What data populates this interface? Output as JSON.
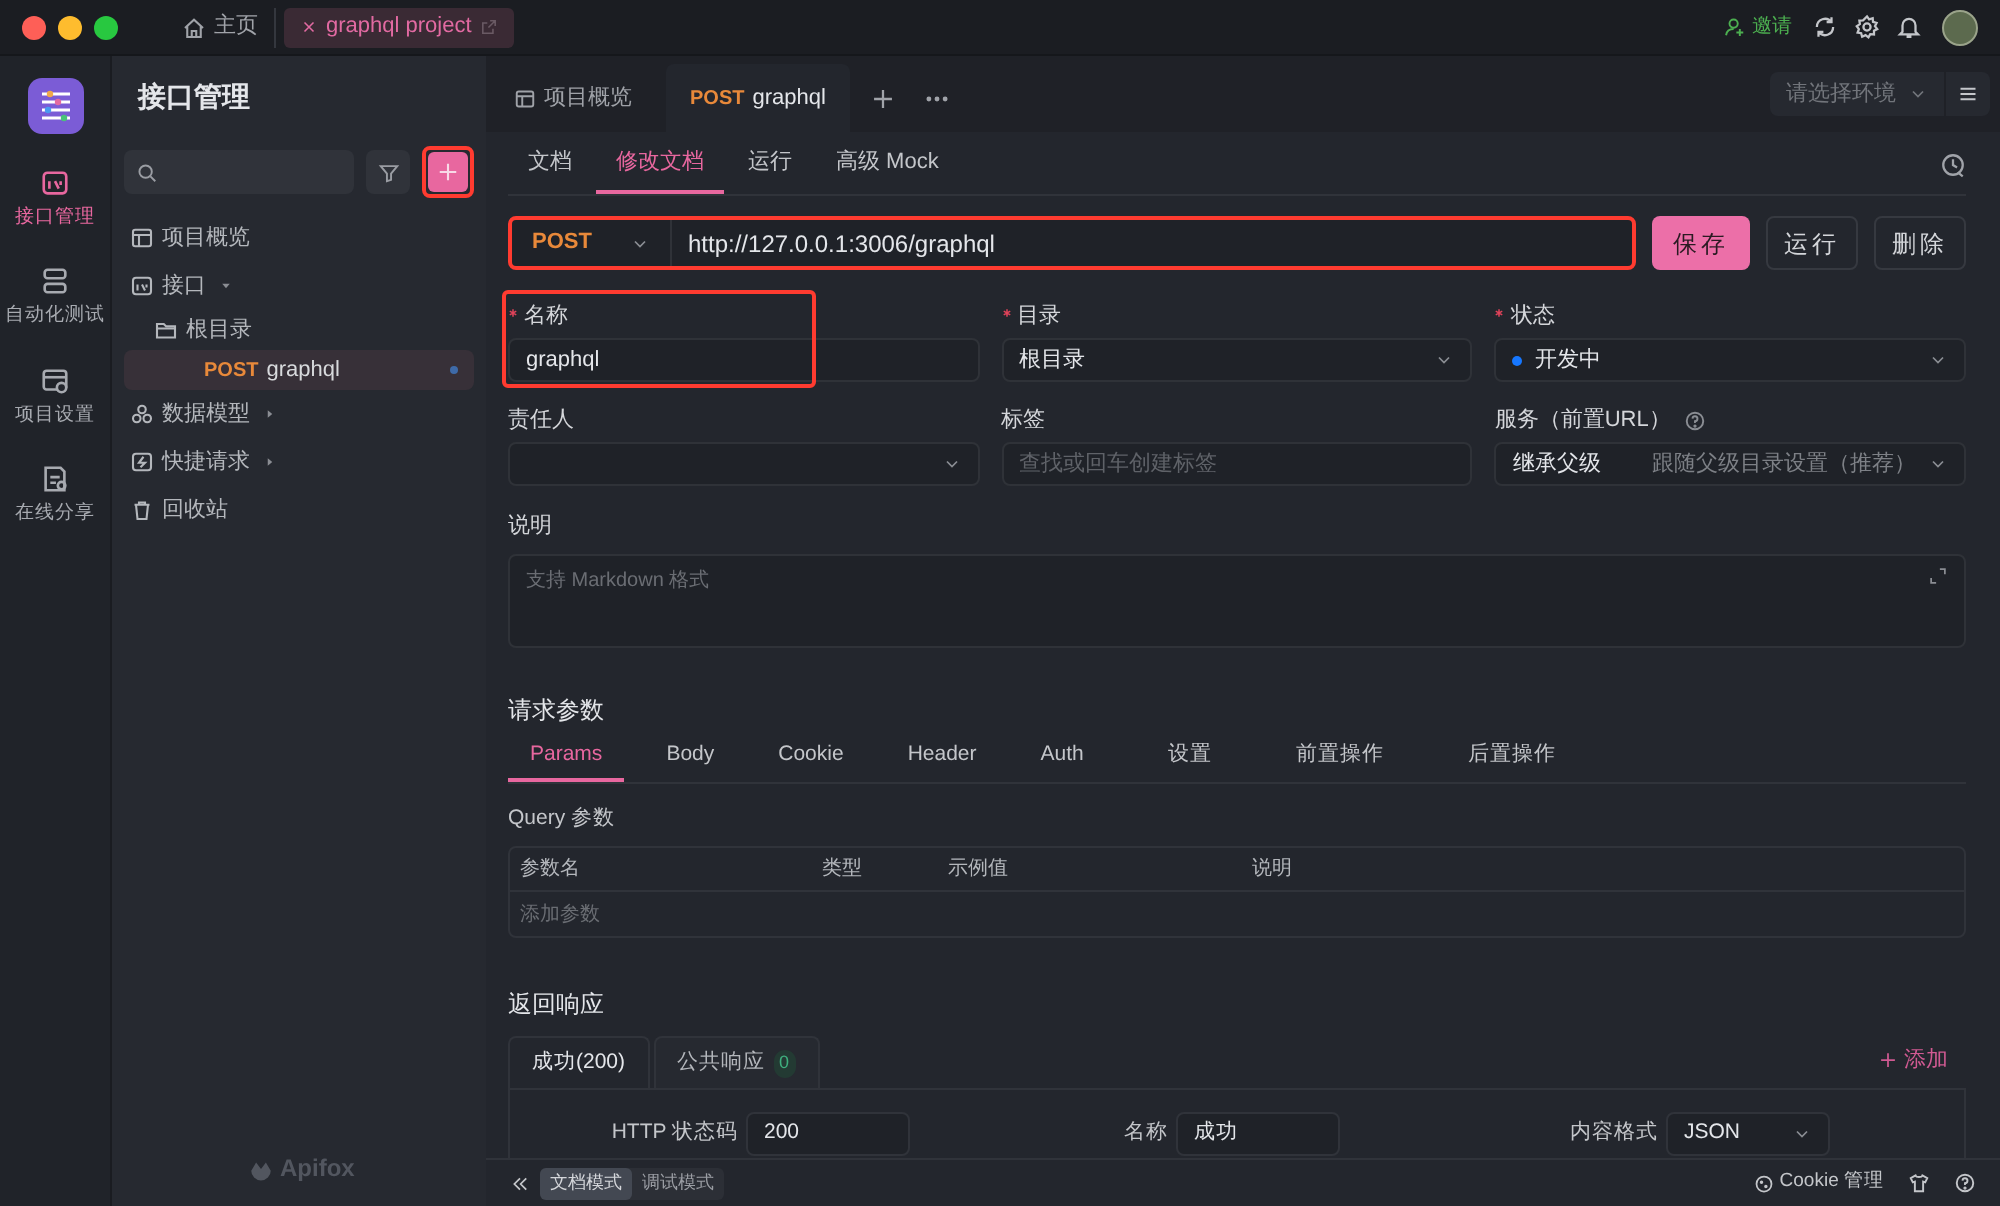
{
  "titlebar": {
    "tabs": [
      {
        "label": "主页",
        "kind": "home",
        "selected": false
      },
      {
        "label": "graphql project",
        "kind": "project",
        "selected": true
      }
    ],
    "invite": "邀请"
  },
  "rail": {
    "items": [
      {
        "label": "接口管理",
        "kind": "api",
        "selected": true
      },
      {
        "label": "自动化测试",
        "kind": "test",
        "selected": false
      },
      {
        "label": "项目设置",
        "kind": "settings",
        "selected": false
      },
      {
        "label": "在线分享",
        "kind": "share",
        "selected": false
      }
    ]
  },
  "sidebar": {
    "title": "接口管理",
    "add_highlighted": true,
    "brand": "Apifox",
    "tree": [
      {
        "label": "项目概览",
        "kind": "overview"
      },
      {
        "label": "接口",
        "kind": "api",
        "expanded": true,
        "children": [
          {
            "label": "根目录",
            "kind": "folder",
            "children": [
              {
                "label": "graphql",
                "kind": "request",
                "method": "POST",
                "selected": true
              }
            ]
          }
        ]
      },
      {
        "label": "数据模型",
        "kind": "model",
        "expanded": false
      },
      {
        "label": "快捷请求",
        "kind": "quick",
        "expanded": false
      },
      {
        "label": "回收站",
        "kind": "trash"
      }
    ]
  },
  "doc_tabs": [
    {
      "label": "项目概览",
      "kind": "overview",
      "selected": false
    },
    {
      "label": "graphql",
      "kind": "request",
      "method": "POST",
      "selected": true
    }
  ],
  "env_select": {
    "placeholder": "请选择环境"
  },
  "sub_tabs": [
    {
      "label": "文档",
      "selected": false
    },
    {
      "label": "修改文档",
      "selected": true
    },
    {
      "label": "运行",
      "selected": false
    },
    {
      "label": "高级 Mock",
      "selected": false
    }
  ],
  "request": {
    "method": "POST",
    "url": "http://127.0.0.1:3006/graphql",
    "highlighted": true
  },
  "actions": [
    {
      "label": "保存",
      "kind": "primary"
    },
    {
      "label": "运行",
      "kind": "default"
    },
    {
      "label": "删除",
      "kind": "default"
    }
  ],
  "fields": [
    {
      "label": "名称",
      "required": true,
      "kind": "input",
      "value": "graphql",
      "highlighted": true
    },
    {
      "label": "目录",
      "required": true,
      "kind": "select",
      "value": "根目录"
    },
    {
      "label": "状态",
      "required": true,
      "kind": "status",
      "value": "开发中",
      "color": "#1677ff"
    },
    {
      "label": "责任人",
      "required": false,
      "kind": "select"
    },
    {
      "label": "标签",
      "required": false,
      "kind": "input",
      "placeholder": "查找或回车创建标签"
    },
    {
      "label": "服务（前置URL）",
      "required": false,
      "kind": "service",
      "help": true,
      "value": "继承父级",
      "hint": "跟随父级目录设置（推荐）"
    }
  ],
  "description": {
    "label": "说明",
    "placeholder": "支持 Markdown 格式"
  },
  "request_params": {
    "title": "请求参数",
    "tabs": [
      {
        "label": "Params",
        "selected": true
      },
      {
        "label": "Body",
        "selected": false
      },
      {
        "label": "Cookie",
        "selected": false
      },
      {
        "label": "Header",
        "selected": false
      },
      {
        "label": "Auth",
        "selected": false
      },
      {
        "label": "设置",
        "selected": false
      },
      {
        "label": "前置操作",
        "selected": false
      },
      {
        "label": "后置操作",
        "selected": false
      }
    ],
    "query": {
      "title": "Query 参数",
      "columns": [
        "参数名",
        "类型",
        "示例值",
        "说明"
      ],
      "add_placeholder": "添加参数"
    }
  },
  "response": {
    "title": "返回响应",
    "add": "添加",
    "tabs": [
      {
        "label": "成功(200)",
        "selected": true
      },
      {
        "label": "公共响应",
        "count": "0",
        "selected": false
      }
    ],
    "status_code_label": "HTTP 状态码",
    "status_code": "200",
    "name_label": "名称",
    "name": "成功",
    "format_label": "内容格式",
    "format": "JSON"
  },
  "status_bar": {
    "modes": [
      {
        "label": "文档模式",
        "selected": true
      },
      {
        "label": "调试模式",
        "selected": false
      }
    ],
    "cookie": "Cookie 管理"
  }
}
